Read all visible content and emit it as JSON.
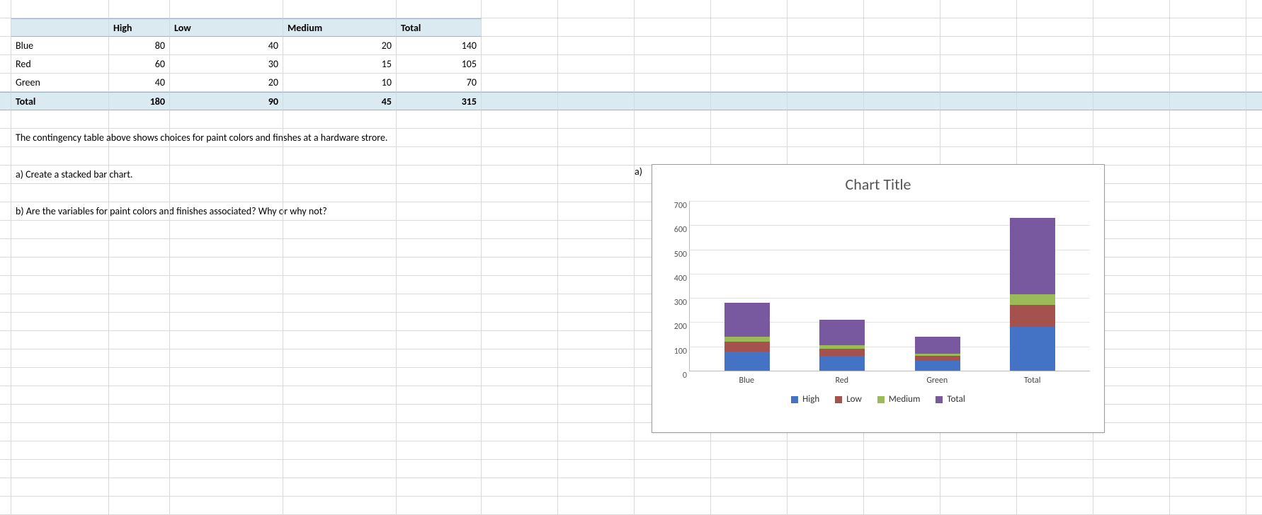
{
  "table": {
    "col_headers": [
      "",
      "High",
      "Low",
      "Medium",
      "Total"
    ],
    "rows": [
      {
        "label": "Blue",
        "high": 80,
        "low": 40,
        "medium": 20,
        "total": 140
      },
      {
        "label": "Red",
        "high": 60,
        "low": 30,
        "medium": 15,
        "total": 105
      },
      {
        "label": "Green",
        "high": 40,
        "low": 20,
        "medium": 10,
        "total": 70
      }
    ],
    "totals": {
      "label": "Total",
      "high": 180,
      "low": 90,
      "medium": 45,
      "total": 315
    }
  },
  "text": {
    "caption": "The contingency table above shows choices for paint colors and finshes at a hardware strore.",
    "qa": "a) Create a stacked bar chart.",
    "qb": "b) Are the variables for paint colors and finishes associated? Why or why not?",
    "answer_a_label": "a)"
  },
  "chart_data": {
    "type": "bar",
    "stacked": true,
    "title": "Chart Title",
    "categories": [
      "Blue",
      "Red",
      "Green",
      "Total"
    ],
    "series": [
      {
        "name": "High",
        "color": "#4472c4",
        "values": [
          80,
          60,
          40,
          180
        ]
      },
      {
        "name": "Low",
        "color": "#a5524f",
        "values": [
          40,
          30,
          20,
          90
        ]
      },
      {
        "name": "Medium",
        "color": "#9bbb59",
        "values": [
          20,
          15,
          10,
          45
        ]
      },
      {
        "name": "Total",
        "color": "#7859a0",
        "values": [
          140,
          105,
          70,
          315
        ]
      }
    ],
    "ylim": [
      0,
      700
    ],
    "yticks": [
      0,
      100,
      200,
      300,
      400,
      500,
      600,
      700
    ],
    "xlabel": "",
    "ylabel": ""
  }
}
